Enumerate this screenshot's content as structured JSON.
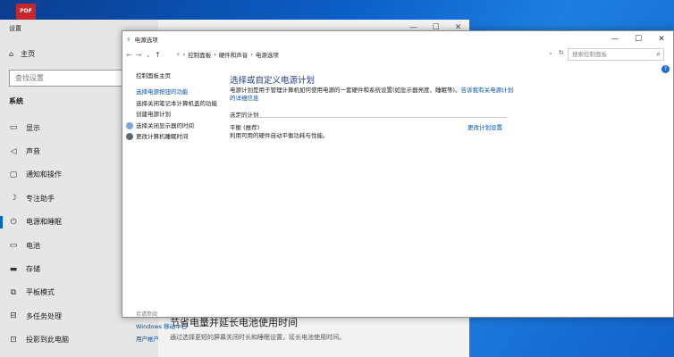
{
  "desktop": {
    "pdf_label": "PDF"
  },
  "settings": {
    "title": "设置",
    "home": "主页",
    "search_placeholder": "查找设置",
    "section": "系统",
    "nav": [
      {
        "label": "显示",
        "icon": "display-icon"
      },
      {
        "label": "声音",
        "icon": "sound-icon"
      },
      {
        "label": "通知和操作",
        "icon": "notification-icon"
      },
      {
        "label": "专注助手",
        "icon": "focus-assist-icon"
      },
      {
        "label": "电源和睡眠",
        "icon": "power-icon"
      },
      {
        "label": "电池",
        "icon": "battery-icon"
      },
      {
        "label": "存储",
        "icon": "storage-icon"
      },
      {
        "label": "平板模式",
        "icon": "tablet-icon"
      },
      {
        "label": "多任务处理",
        "icon": "multitask-icon"
      },
      {
        "label": "投影到此电脑",
        "icon": "project-icon"
      }
    ],
    "active_index": 4,
    "bottom_title": "节省电量并延长电池使用时间",
    "bottom_desc": "通过选择更短的屏幕关闭时长和睡眠设置，延长电池使用时间。"
  },
  "control_panel": {
    "title": "电源选项",
    "breadcrumb": [
      "控制面板",
      "硬件和声音",
      "电源选项"
    ],
    "search_placeholder": "搜索控制面板",
    "sidebar": {
      "home": "控制面板主页",
      "links": [
        "选择电源按钮的功能",
        "选择关闭笔记本计算机盖的功能",
        "创建电源计划",
        "选择关闭显示器的时间",
        "更改计算机睡眠时间"
      ],
      "see_also": "另请参阅",
      "see_also_links": [
        "Windows 移动中心",
        "用户帐户"
      ]
    },
    "main": {
      "title": "选择或自定义电源计划",
      "desc": "电源计划是用于管理计算机如何使用电源的一套硬件和系统设置(如显示器亮度、睡眠等)。",
      "desc_link": "告诉我有关电源计划的详细信息",
      "selected_plan_label": "选定的计划",
      "plan_name": "平衡 (推荐)",
      "plan_desc": "利用可用的硬件自动平衡功耗与性能。",
      "change_link": "更改计划设置"
    }
  },
  "colors": {
    "accent": "#0067c0",
    "link": "#0050a8",
    "title_blue": "#1e3c8c"
  }
}
